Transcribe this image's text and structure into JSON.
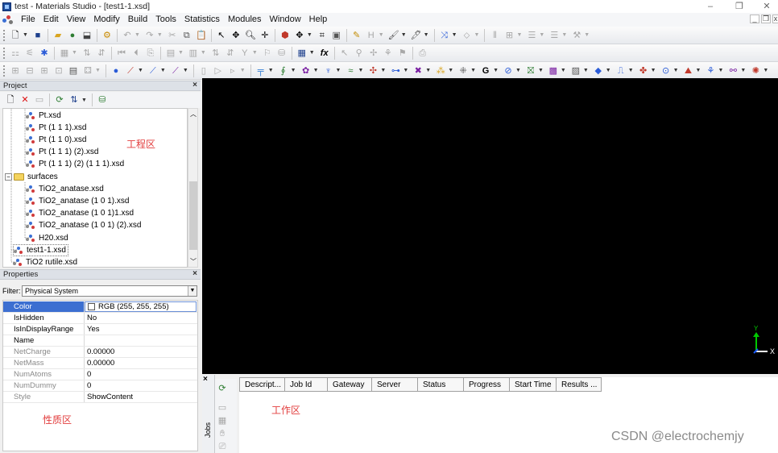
{
  "window": {
    "title": "test - Materials Studio - [test1-1.xsd]",
    "minimize": "–",
    "restore": "❐",
    "close": "✕",
    "mdi_min": "_",
    "mdi_restore": "❐",
    "mdi_close": "x"
  },
  "menu": [
    "File",
    "Edit",
    "View",
    "Modify",
    "Build",
    "Tools",
    "Statistics",
    "Modules",
    "Window",
    "Help"
  ],
  "toolbars": {
    "row1": [
      "new-file",
      "open-folder",
      "save",
      "import",
      "export",
      "print",
      "print-preview",
      "properties",
      "undo",
      "redo",
      "cut",
      "copy",
      "paste",
      "select-arrow",
      "rotate",
      "zoom",
      "translate",
      "display-style",
      "reset-view",
      "fit",
      "color",
      "sketch-pencil",
      "hydrogen",
      "brush",
      "brush-2",
      "symmetry",
      "crystal",
      "sep",
      "grid",
      "list",
      "menu"
    ],
    "row2": [
      "align",
      "find",
      "graph",
      "table",
      "sort-asc",
      "sort-desc",
      "first",
      "prev",
      "link",
      "chart",
      "settings",
      "sort-a",
      "sort-z",
      "filter",
      "flag",
      "db",
      "spreadsheet",
      "function",
      "pointer",
      "search",
      "move",
      "tree",
      "collab",
      "export-2"
    ],
    "row3": [
      "grid-1",
      "grid-2",
      "grid-3",
      "grid-4",
      "window",
      "layout",
      "atom",
      "bond",
      "bond-2",
      "bond-3",
      "doc",
      "play",
      "forward",
      "amorphous",
      "phonon",
      "dmol",
      "forcite",
      "mesocite",
      "castep",
      "conformers",
      "adsorption",
      "sorption",
      "gulp",
      "dftb",
      "morphology",
      "reflex",
      "polymorph",
      "vamp",
      "qsar",
      "synthia",
      "blends",
      "equilibria",
      "onetep",
      "visualizer"
    ]
  },
  "project": {
    "title": "Project",
    "close": "×",
    "tree": [
      {
        "label": "Pt.xsd",
        "depth": 2,
        "type": "file"
      },
      {
        "label": "Pt (1 1 1).xsd",
        "depth": 2,
        "type": "file"
      },
      {
        "label": "Pt (1 1 0).xsd",
        "depth": 2,
        "type": "file"
      },
      {
        "label": "Pt (1 1 1) (2).xsd",
        "depth": 2,
        "type": "file"
      },
      {
        "label": "Pt (1 1 1) (2) (1 1 1).xsd",
        "depth": 2,
        "type": "file"
      },
      {
        "label": "surfaces",
        "depth": 1,
        "type": "folder",
        "expander": "−"
      },
      {
        "label": "TiO2_anatase.xsd",
        "depth": 2,
        "type": "file"
      },
      {
        "label": "TiO2_anatase (1 0 1).xsd",
        "depth": 2,
        "type": "file"
      },
      {
        "label": "TiO2_anatase (1 0 1)1.xsd",
        "depth": 2,
        "type": "file"
      },
      {
        "label": "TiO2_anatase (1 0 1) (2).xsd",
        "depth": 2,
        "type": "file"
      },
      {
        "label": "H20.xsd",
        "depth": 2,
        "type": "file"
      },
      {
        "label": "test1-1.xsd",
        "depth": 1,
        "type": "file",
        "active": true
      },
      {
        "label": "TiO2 rutile.xsd",
        "depth": 1,
        "type": "file"
      }
    ],
    "annotation": "工程区"
  },
  "properties": {
    "title": "Properties",
    "close": "×",
    "filter_label": "Filter:",
    "filter_value": "Physical System",
    "rows": [
      {
        "key": "Color",
        "value": "RGB (255, 255, 255)",
        "selected": true,
        "swatch": true
      },
      {
        "key": "IsHidden",
        "value": "No"
      },
      {
        "key": "IsInDisplayRange",
        "value": "Yes"
      },
      {
        "key": "Name",
        "value": ""
      },
      {
        "key": "NetCharge",
        "value": "0.00000",
        "gray": true
      },
      {
        "key": "NetMass",
        "value": "0.00000",
        "gray": true
      },
      {
        "key": "NumAtoms",
        "value": "0",
        "gray": true
      },
      {
        "key": "NumDummy",
        "value": "0",
        "gray": true
      },
      {
        "key": "Style",
        "value": "ShowContent",
        "gray": true
      }
    ],
    "annotation": "性质区"
  },
  "viewer": {
    "axis_y": "Y",
    "axis_x": "X",
    "colors": {
      "y_axis": "#00c800",
      "x_axis": "#ffffff",
      "z_axis": "#1a5cff"
    }
  },
  "jobs": {
    "label": "Jobs",
    "close": "×",
    "columns": [
      "Descript...",
      "Job Id",
      "Gateway",
      "Server",
      "Status",
      "Progress",
      "Start Time",
      "Results ..."
    ],
    "annotation": "工作区"
  },
  "watermark": "CSDN @electrochemjy"
}
